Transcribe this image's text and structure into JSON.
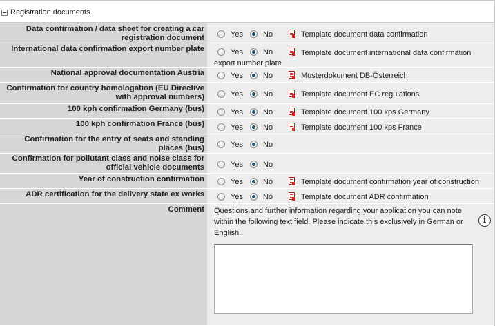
{
  "section": {
    "title": "Registration documents"
  },
  "options": {
    "yes": "Yes",
    "no": "No"
  },
  "rows": [
    {
      "label": "Data confirmation / data sheet for creating a car registration document",
      "selected": "no",
      "document": "Template document data confirmation"
    },
    {
      "label": "International data confirmation export number plate",
      "selected": "no",
      "document": "Template document international data confirmation export number plate"
    },
    {
      "label": "National approval documentation Austria",
      "selected": "no",
      "document": "Musterdokument DB-Österreich"
    },
    {
      "label": "Confirmation for country homologation (EU Directive with approval numbers)",
      "selected": "no",
      "document": "Template document EC regulations"
    },
    {
      "label": "100 kph confirmation Germany (bus)",
      "selected": "no",
      "document": "Template document 100 kps Germany"
    },
    {
      "label": "100 kph confirmation France (bus)",
      "selected": "no",
      "document": "Template document 100 kps France"
    },
    {
      "label": "Confirmation for the entry of seats and standing places (bus)",
      "selected": "no",
      "document": ""
    },
    {
      "label": "Confirmation for pollutant class and noise class for official vehicle documents",
      "selected": "no",
      "document": ""
    },
    {
      "label": "Year of construction confirmation",
      "selected": "no",
      "document": "Template document confirmation year of construction"
    },
    {
      "label": "ADR certification for the delivery state ex works",
      "selected": "no",
      "document": "Template document ADR confirmation"
    }
  ],
  "comment": {
    "label": "Comment",
    "instructions": "Questions and further information regarding your application you can note within the following text field. Please indicate this exclusively in German or English.",
    "value": "",
    "info_icon": "info-icon"
  },
  "icons": {
    "toggle": "collapse-minus-icon",
    "document": "pdf-document-icon"
  }
}
